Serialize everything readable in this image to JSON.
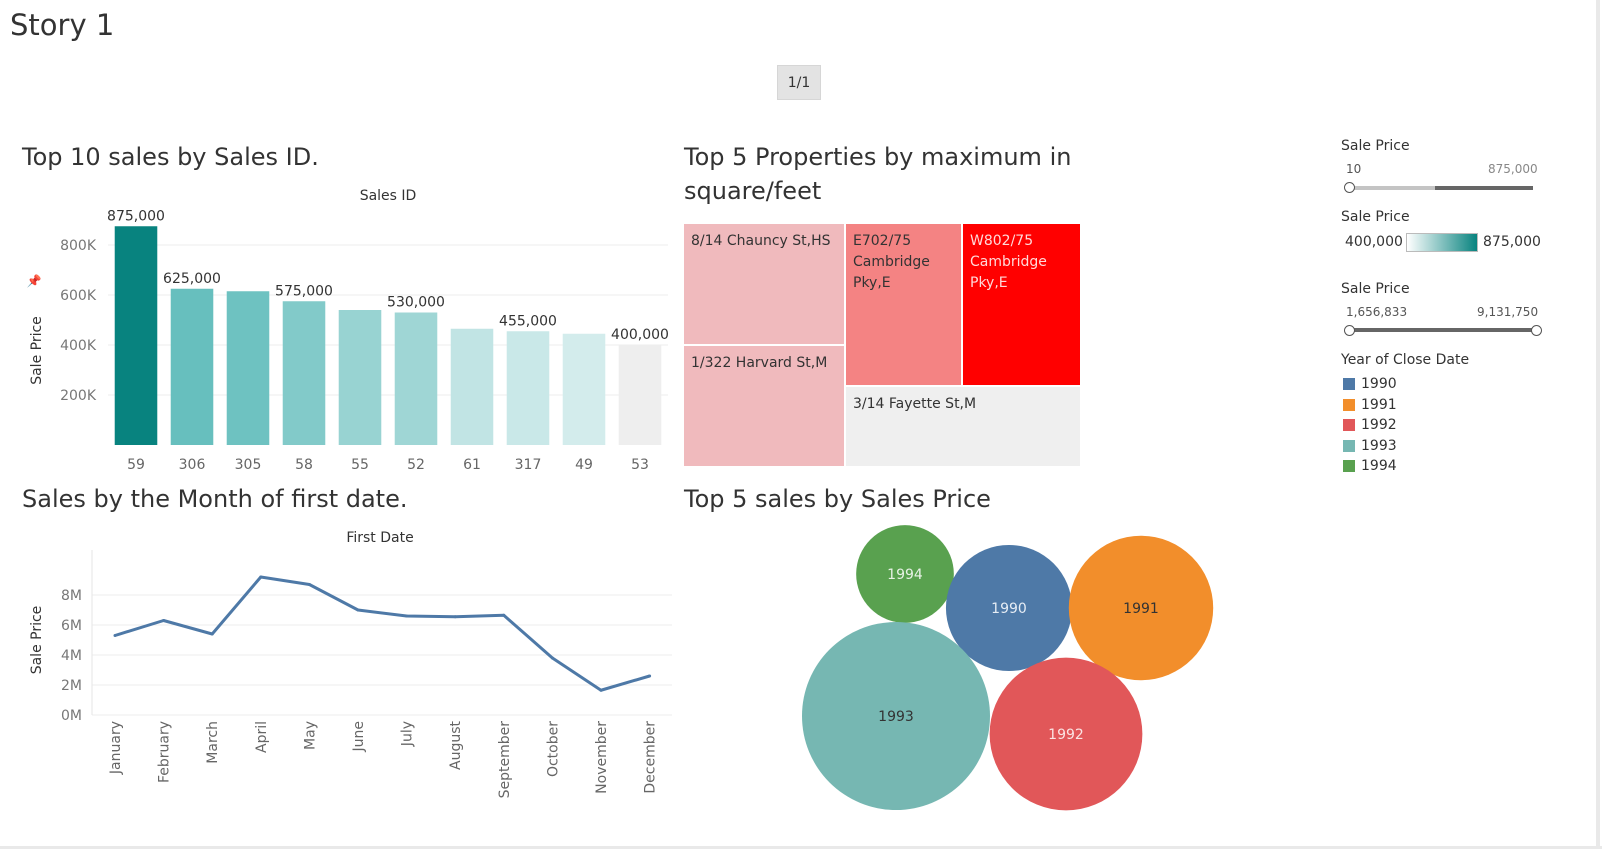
{
  "story": {
    "title": "Story 1",
    "page_nav": "1/1"
  },
  "sheets": {
    "bar_title": "Top 10 sales by Sales ID.",
    "treemap_title_line1": "Top 5 Properties by maximum in",
    "treemap_title_line2": "square/feet",
    "line_title": "Sales by the Month of first date.",
    "bubble_title": "Top 5 sales by Sales Price"
  },
  "chart_data": [
    {
      "type": "bar",
      "title": "Top 10 sales by Sales ID.",
      "header": "Sales ID",
      "ylabel": "Sale Price",
      "categories": [
        "59",
        "306",
        "305",
        "58",
        "55",
        "52",
        "61",
        "317",
        "49",
        "53"
      ],
      "values": [
        875000,
        625000,
        615000,
        575000,
        540000,
        530000,
        465000,
        455000,
        445000,
        400000
      ],
      "data_labels": [
        "875,000",
        "625,000",
        "",
        "575,000",
        "",
        "530,000",
        "",
        "455,000",
        "",
        "400,000"
      ],
      "colors": [
        "#08837f",
        "#67bfbe",
        "#6ec2c1",
        "#82cac9",
        "#98d3d2",
        "#9fd6d5",
        "#c1e4e4",
        "#c9e8e8",
        "#d3ecec",
        "#eeeeee"
      ],
      "yticks": [
        "200K",
        "400K",
        "600K",
        "800K"
      ],
      "ytick_values": [
        200000,
        400000,
        600000,
        800000
      ],
      "ylim": [
        0,
        900000
      ]
    },
    {
      "type": "treemap",
      "title": "Top 5 Properties by maximum in square/feet",
      "items": [
        {
          "lines": [
            "8/14 Chauncy St,HS"
          ],
          "color": "#f0babd",
          "text_color": "#333333"
        },
        {
          "lines": [
            "1/322 Harvard St,M"
          ],
          "color": "#f0babd",
          "text_color": "#333333"
        },
        {
          "lines": [
            "E702/75",
            "Cambridge",
            "Pky,E"
          ],
          "color": "#f48383",
          "text_color": "#333333"
        },
        {
          "lines": [
            "W802/75",
            "Cambridge",
            "Pky,E"
          ],
          "color": "#ff0000",
          "text_color": "#ffd9d9"
        },
        {
          "lines": [
            "3/14 Fayette St,M"
          ],
          "color": "#efefef",
          "text_color": "#333333"
        }
      ]
    },
    {
      "type": "line",
      "title": "Sales by the Month of first date.",
      "header": "First Date",
      "ylabel": "Sale Price",
      "categories": [
        "January",
        "February",
        "March",
        "April",
        "May",
        "June",
        "July",
        "August",
        "September",
        "October",
        "November",
        "December"
      ],
      "values": [
        5300000,
        6300000,
        5400000,
        9200000,
        8700000,
        7000000,
        6600000,
        6550000,
        6650000,
        3800000,
        1650000,
        2600000
      ],
      "color": "#4e79a7",
      "yticks": [
        "0M",
        "2M",
        "4M",
        "6M",
        "8M"
      ],
      "ytick_values": [
        0,
        2000000,
        4000000,
        6000000,
        8000000
      ],
      "ylim": [
        0,
        10000000
      ]
    },
    {
      "type": "bubble",
      "title": "Top 5 sales by Sales Price",
      "bubbles": [
        {
          "label": "1994",
          "color": "#59a14f",
          "text_color": "#e8f2e6",
          "size": 0.27
        },
        {
          "label": "1990",
          "color": "#4e79a7",
          "text_color": "#e6edf5",
          "size": 0.45
        },
        {
          "label": "1991",
          "color": "#f28e2b",
          "text_color": "#333333",
          "size": 0.59
        },
        {
          "label": "1993",
          "color": "#76b7b2",
          "text_color": "#333333",
          "size": 1.0
        },
        {
          "label": "1992",
          "color": "#e15759",
          "text_color": "#fbe4e4",
          "size": 0.66
        }
      ]
    }
  ],
  "filters": {
    "range1": {
      "title": "Sale Price",
      "min": "10",
      "max": "875,000"
    },
    "color_legend": {
      "title": "Sale Price",
      "min": "400,000",
      "max": "875,000",
      "color_from": "#ffffff",
      "color_to": "#08837f"
    },
    "range2": {
      "title": "Sale Price",
      "min": "1,656,833",
      "max": "9,131,750"
    }
  },
  "year_legend": {
    "title": "Year of Close Date",
    "items": [
      {
        "label": "1990",
        "color": "#4e79a7"
      },
      {
        "label": "1991",
        "color": "#f28e2b"
      },
      {
        "label": "1992",
        "color": "#e15759"
      },
      {
        "label": "1993",
        "color": "#76b7b2"
      },
      {
        "label": "1994",
        "color": "#59a14f"
      }
    ]
  }
}
